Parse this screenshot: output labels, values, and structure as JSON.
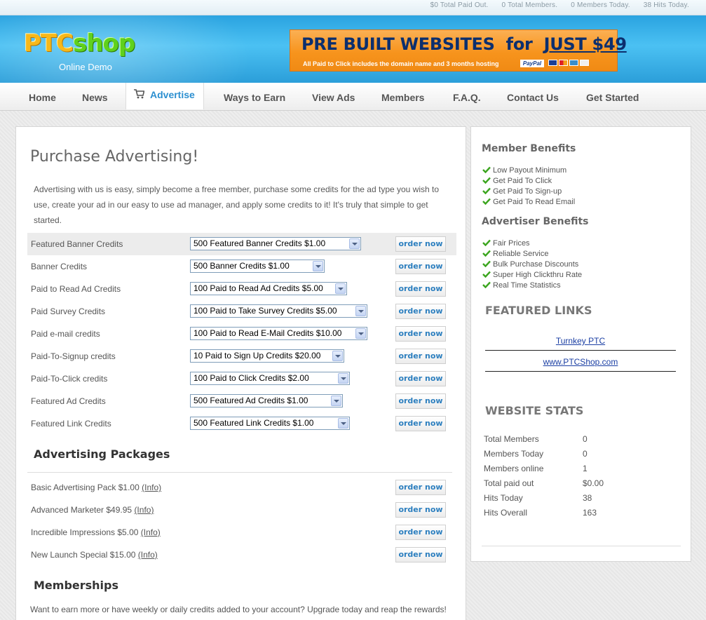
{
  "top_stats": {
    "paid_out": "$0 Total Paid Out.",
    "members": "0 Total Members.",
    "members_today": "0 Members Today.",
    "hits": "38 Hits Today."
  },
  "logo": {
    "ptc": "PTC",
    "shop": "shop",
    "subtitle": "Online Demo"
  },
  "banner": {
    "lead": "PRE BUILT WEBSITES",
    "for": "for",
    "price": "JUST $49",
    "sub": "All Paid to Click includes the domain name and 3 months hosting",
    "paypal": "PayPal"
  },
  "nav": [
    "Home",
    "News",
    "Advertise",
    "Ways to Earn",
    "View Ads",
    "Members",
    "F.A.Q.",
    "Contact Us",
    "Get Started"
  ],
  "main": {
    "title": "Purchase Advertising!",
    "intro": "Advertising with us is easy, simply become a free member, purchase some credits for the ad type you wish to use, create your ad in our easy to use ad manager, and apply some credits to it! It's truly that simple to get started.",
    "order_label": "order now",
    "ad_rows": [
      {
        "label": "Featured Banner Credits",
        "selected": "500 Featured Banner Credits $1.00"
      },
      {
        "label": "Banner Credits",
        "selected": "500 Banner Credits $1.00"
      },
      {
        "label": "Paid to Read Ad Credits",
        "selected": "100 Paid to Read Ad Credits $5.00"
      },
      {
        "label": "Paid Survey Credits",
        "selected": "100 Paid to Take Survey Credits $5.00"
      },
      {
        "label": "Paid e-mail credits",
        "selected": "100 Paid to Read E-Mail Credits $10.00"
      },
      {
        "label": "Paid-To-Signup credits",
        "selected": "10 Paid to Sign Up Credits $20.00"
      },
      {
        "label": "Paid-To-Click credits",
        "selected": "100 Paid to Click Credits $2.00"
      },
      {
        "label": "Featured Ad Credits",
        "selected": "500 Featured Ad Credits $1.00"
      },
      {
        "label": "Featured Link Credits",
        "selected": "500 Featured Link Credits $1.00"
      }
    ],
    "packages_heading": "Advertising Packages",
    "info_label": "(Info)",
    "packages": [
      {
        "label": "Basic Advertising Pack $1.00"
      },
      {
        "label": "Advanced Marketer $49.95"
      },
      {
        "label": "Incredible Impressions $5.00"
      },
      {
        "label": "New Launch Special $15.00"
      }
    ],
    "memberships_heading": "Memberships",
    "memberships_text": "Want to earn more or have weekly or daily credits added to your account? Upgrade today and reap the rewards!"
  },
  "sidebar": {
    "member_benefits_heading": "Member Benefits",
    "member_benefits": [
      "Low Payout Minimum",
      "Get Paid To Click",
      "Get Paid To Sign-up",
      "Get Paid To Read Email"
    ],
    "advertiser_benefits_heading": "Advertiser Benefits",
    "advertiser_benefits": [
      "Fair Prices",
      "Reliable Service",
      "Bulk Purchase Discounts",
      "Super High Clickthru Rate",
      "Real Time Statistics"
    ],
    "featured_links_heading": "FEATURED LINKS",
    "featured_links": [
      "Turnkey PTC",
      "www.PTCShop.com"
    ],
    "website_stats_heading": "WEBSITE STATS",
    "stats": [
      {
        "label": "Total Members",
        "value": "0"
      },
      {
        "label": "Members Today",
        "value": "0"
      },
      {
        "label": "Members online",
        "value": "1"
      },
      {
        "label": "Total paid out",
        "value": "$0.00"
      },
      {
        "label": "Hits Today",
        "value": "38"
      },
      {
        "label": "Hits Overall",
        "value": "163"
      }
    ]
  },
  "colors": {
    "header_blue": "#2aa3e0",
    "nav_active": "#2c8fd0",
    "order_button_text": "#2c7fbf",
    "banner_orange": "#f7941d",
    "banner_navy": "#0c2f6e",
    "check_green": "#3ba51e",
    "link_blue": "#1a3ea3"
  }
}
